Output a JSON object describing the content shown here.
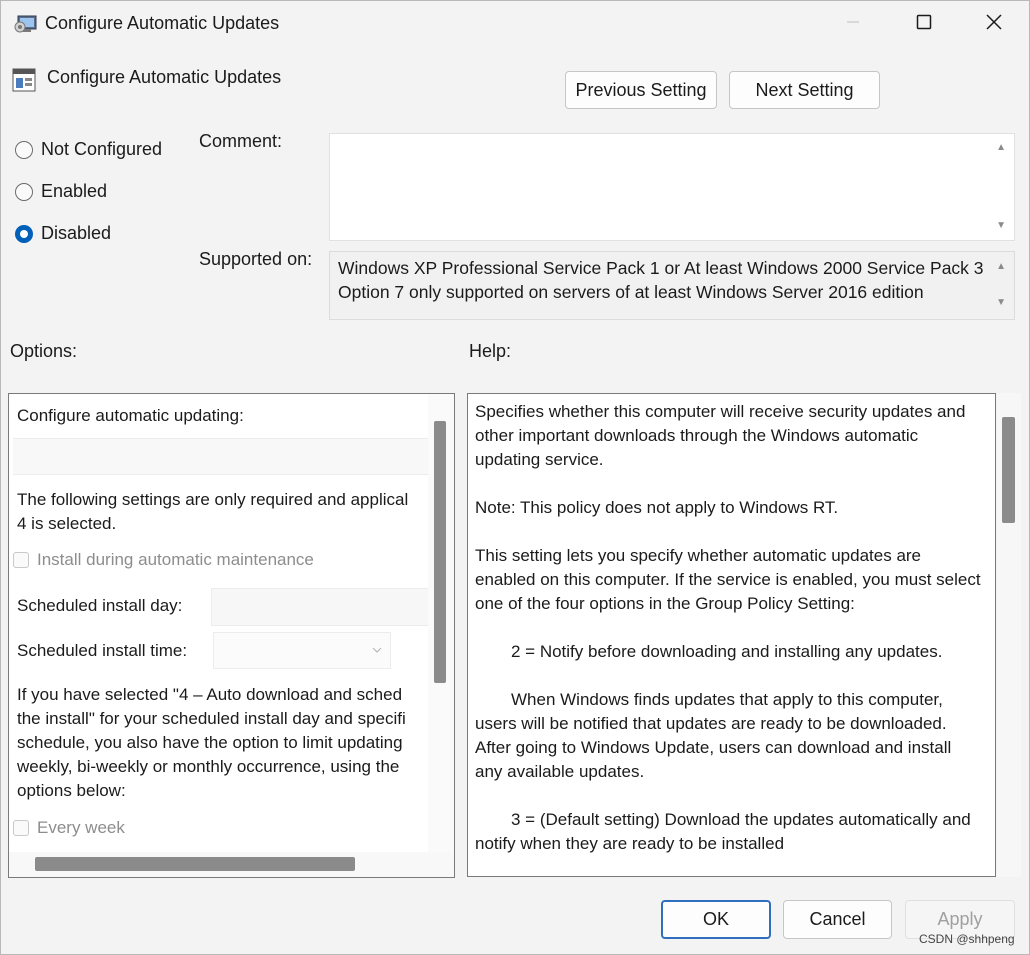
{
  "window": {
    "title": "Configure Automatic Updates",
    "controls": {
      "minimize_icon": "minimize-icon",
      "maximize_icon": "maximize-icon",
      "close_icon": "close-icon"
    }
  },
  "header": {
    "policy_title": "Configure Automatic Updates",
    "previous_setting": "Previous Setting",
    "next_setting": "Next Setting"
  },
  "state": {
    "options": [
      {
        "label": "Not Configured",
        "selected": false
      },
      {
        "label": "Enabled",
        "selected": false
      },
      {
        "label": "Disabled",
        "selected": true
      }
    ]
  },
  "comment": {
    "label": "Comment:",
    "value": ""
  },
  "supported": {
    "label": "Supported on:",
    "lines": [
      "Windows XP Professional Service Pack 1 or At least Windows 2000 Service Pack 3",
      "Option 7 only supported on servers of at least Windows Server 2016 edition"
    ]
  },
  "options_section": {
    "label": "Options:",
    "configure_label": "Configure automatic updating:",
    "note_lines": [
      "The following settings are only required and applical",
      "4 is selected."
    ],
    "install_maintenance": "Install during automatic maintenance",
    "scheduled_day_label": "Scheduled install day:",
    "scheduled_time_label": "Scheduled install time:",
    "info_lines": [
      "If you have selected \"4 – Auto download and sched",
      "the install\" for your scheduled install day and specifi",
      "schedule, you also have the option to limit updating",
      "weekly, bi-weekly or monthly occurrence, using the",
      "options below:"
    ],
    "every_week": "Every week"
  },
  "help_section": {
    "label": "Help:",
    "paragraphs": [
      "Specifies whether this computer will receive security updates and other important downloads through the Windows automatic updating service.",
      "Note: This policy does not apply to Windows RT.",
      "This setting lets you specify whether automatic updates are enabled on this computer. If the service is enabled, you must select one of the four options in the Group Policy Setting:",
      "2 = Notify before downloading and installing any updates.",
      "When Windows finds updates that apply to this computer, users will be notified that updates are ready to be downloaded. After going to Windows Update, users can download and install any available updates.",
      "3 = (Default setting) Download the updates automatically and notify when they are ready to be installed"
    ]
  },
  "footer": {
    "ok": "OK",
    "cancel": "Cancel",
    "apply": "Apply",
    "watermark": "CSDN @shhpeng"
  },
  "colors": {
    "accent": "#005fb8",
    "background": "#f3f3f3"
  }
}
